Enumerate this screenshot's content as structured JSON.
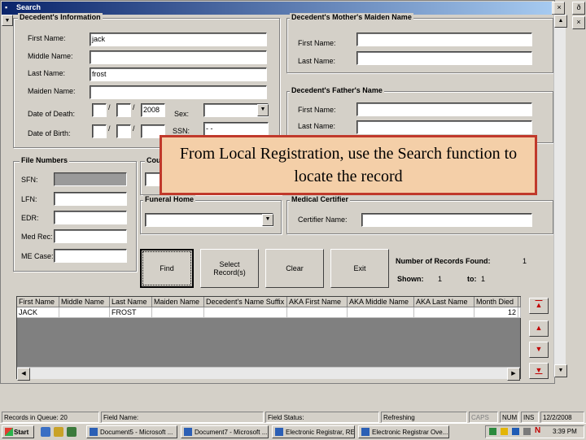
{
  "window": {
    "title": "Search",
    "min": "_",
    "restore": "□",
    "close": "×",
    "outer_restore": "ð",
    "outer_close": "×"
  },
  "decedent": {
    "legend": "Decedent's Information",
    "first_name_label": "First Name:",
    "first_name": "jack",
    "middle_name_label": "Middle Name:",
    "middle_name": "",
    "last_name_label": "Last Name:",
    "last_name": "frost",
    "maiden_name_label": "Maiden Name:",
    "maiden_name": "",
    "dod_label": "Date of Death:",
    "dod_month": "",
    "dod_day": "",
    "dod_year": "2008",
    "dob_label": "Date of Birth:",
    "dob_month": "",
    "dob_day": "",
    "dob_year": "",
    "sep": "/",
    "sex_label": "Sex:",
    "sex": "",
    "ssn_label": "SSN:",
    "ssn": "- -"
  },
  "mother": {
    "legend": "Decedent's Mother's Maiden Name",
    "first_name_label": "First Name:",
    "first_name": "",
    "last_name_label": "Last Name:",
    "last_name": ""
  },
  "father": {
    "legend": "Decedent's Father's Name",
    "first_name_label": "First Name:",
    "first_name": "",
    "last_name_label": "Last Name:",
    "last_name": ""
  },
  "file_numbers": {
    "legend": "File Numbers",
    "sfn_label": "SFN:",
    "sfn": "",
    "lfn_label": "LFN:",
    "lfn": "",
    "edr_label": "EDR:",
    "edr": "",
    "medrec_label": "Med Rec:",
    "medrec": "",
    "mecase_label": "ME Case:",
    "mecase": ""
  },
  "county": {
    "legend": "Cou",
    "value": ""
  },
  "funeral_home": {
    "legend": "Funeral Home",
    "value": ""
  },
  "medical_certifier": {
    "legend": "Medical Certifier",
    "certifier_label": "Certifier Name:",
    "certifier": ""
  },
  "buttons": {
    "find": "Find",
    "select": "Select\nRecord(s)",
    "clear": "Clear",
    "exit": "Exit"
  },
  "records": {
    "found_label": "Number of Records Found:",
    "found": "1",
    "shown_label": "Shown:",
    "shown_from": "1",
    "to_label": "to:",
    "shown_to": "1"
  },
  "grid": {
    "columns": [
      "First Name",
      "Middle Name",
      "Last Name",
      "Maiden Name",
      "Decedent's Name Suffix",
      "AKA First Name",
      "AKA Middle Name",
      "AKA Last Name",
      "Month Died",
      "D"
    ],
    "rows": [
      [
        "JACK",
        "",
        "FROST",
        "",
        "",
        "",
        "",
        "",
        "12",
        ""
      ]
    ]
  },
  "nav": {
    "first": "▲",
    "up": "▲",
    "down": "▼",
    "last": "▼"
  },
  "callout": "From Local Registration, use the Search function to locate the record",
  "statusbar": {
    "queue": "Records in Queue: 20",
    "field_name": "Field Name:",
    "field_status": "Field Status:",
    "refreshing": "Refreshing",
    "caps": "CAPS",
    "num": "NUM",
    "ins": "INS",
    "date": "12/2/2008"
  },
  "taskbar": {
    "start": "Start",
    "tasks": [
      "Document5 - Microsoft ...",
      "Document7 - Microsoft ...",
      "Electronic Registrar, REG...",
      "Electronic Registrar Ove..."
    ],
    "clock": "3:39 PM"
  }
}
